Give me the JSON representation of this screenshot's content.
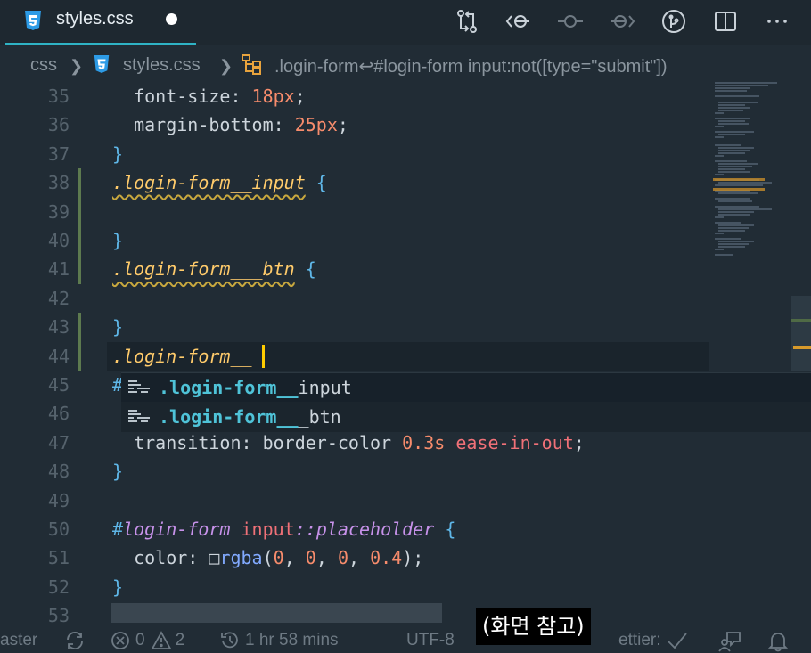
{
  "tab": {
    "title": "styles.css",
    "dirty": true
  },
  "breadcrumb": {
    "folder": "css",
    "file": "styles.css",
    "symbol": ".login-form↩#login-form input:not([type=\"submit\"])"
  },
  "lines": [
    {
      "n": "35",
      "tokens": [
        [
          "t-prop",
          "  font-size"
        ],
        [
          "t-punc",
          ": "
        ],
        [
          "t-num",
          "18px"
        ],
        [
          "t-punc",
          ";"
        ]
      ]
    },
    {
      "n": "36",
      "tokens": [
        [
          "t-prop",
          "  margin-bottom"
        ],
        [
          "t-punc",
          ": "
        ],
        [
          "t-num",
          "25px"
        ],
        [
          "t-punc",
          ";"
        ]
      ]
    },
    {
      "n": "37",
      "tokens": [
        [
          "t-brace",
          "}"
        ]
      ]
    },
    {
      "n": "38",
      "tokens": [
        [
          "t-sel squiggle",
          ".login-form__input"
        ],
        [
          "t-punc",
          " "
        ],
        [
          "t-brace",
          "{"
        ]
      ]
    },
    {
      "n": "39",
      "tokens": []
    },
    {
      "n": "40",
      "tokens": [
        [
          "t-brace",
          "}"
        ]
      ]
    },
    {
      "n": "41",
      "tokens": [
        [
          "t-sel squiggle",
          ".login-form___btn"
        ],
        [
          "t-punc",
          " "
        ],
        [
          "t-brace",
          "{"
        ]
      ]
    },
    {
      "n": "42",
      "tokens": []
    },
    {
      "n": "43",
      "tokens": [
        [
          "t-brace",
          "}"
        ]
      ]
    },
    {
      "n": "44",
      "tokens": [
        [
          "t-sel",
          ".login-form__"
        ]
      ]
    },
    {
      "n": "45",
      "tokens": [
        [
          "t-hash",
          "#"
        ]
      ]
    },
    {
      "n": "46",
      "tokens": []
    },
    {
      "n": "47",
      "tokens": [
        [
          "t-prop",
          "  transition"
        ],
        [
          "t-punc",
          ": border-color "
        ],
        [
          "t-num",
          "0.3s"
        ],
        [
          "t-punc",
          " "
        ],
        [
          "t-el",
          "ease-in-out"
        ],
        [
          "t-punc",
          ";"
        ]
      ]
    },
    {
      "n": "48",
      "tokens": [
        [
          "t-brace",
          "}"
        ]
      ]
    },
    {
      "n": "49",
      "tokens": []
    },
    {
      "n": "50",
      "tokens": [
        [
          "t-hash",
          "#"
        ],
        [
          "t-id",
          "login-form"
        ],
        [
          "t-punc",
          " "
        ],
        [
          "t-el",
          "input"
        ],
        [
          "t-pseudo",
          "::placeholder"
        ],
        [
          "t-punc",
          " "
        ],
        [
          "t-brace",
          "{"
        ]
      ]
    },
    {
      "n": "51",
      "tokens": [
        [
          "t-prop",
          "  color"
        ],
        [
          "t-punc",
          ": "
        ],
        [
          "t-punc",
          "□"
        ],
        [
          "t-fn",
          "rgba"
        ],
        [
          "t-punc",
          "("
        ],
        [
          "t-num",
          "0"
        ],
        [
          "t-punc",
          ", "
        ],
        [
          "t-num",
          "0"
        ],
        [
          "t-punc",
          ", "
        ],
        [
          "t-num",
          "0"
        ],
        [
          "t-punc",
          ", "
        ],
        [
          "t-num",
          "0.4"
        ],
        [
          "t-punc",
          ");"
        ]
      ]
    },
    {
      "n": "52",
      "tokens": [
        [
          "t-brace",
          "}"
        ]
      ]
    },
    {
      "n": "53",
      "tokens": []
    }
  ],
  "suggestions": [
    {
      "match": ".login-form__",
      "rest": "input"
    },
    {
      "match": ".login-form__",
      "rest": "_btn"
    }
  ],
  "status": {
    "branch": "aster",
    "errors": "0",
    "warnings": "2",
    "time": "1 hr 58 mins",
    "encoding": "UTF-8",
    "formatter": "ettier:"
  },
  "caption": "(화면 참고)",
  "colors": {
    "accent": "#2fb3c5",
    "cursor": "#ffcc00",
    "selector": "#ffcb6b"
  }
}
